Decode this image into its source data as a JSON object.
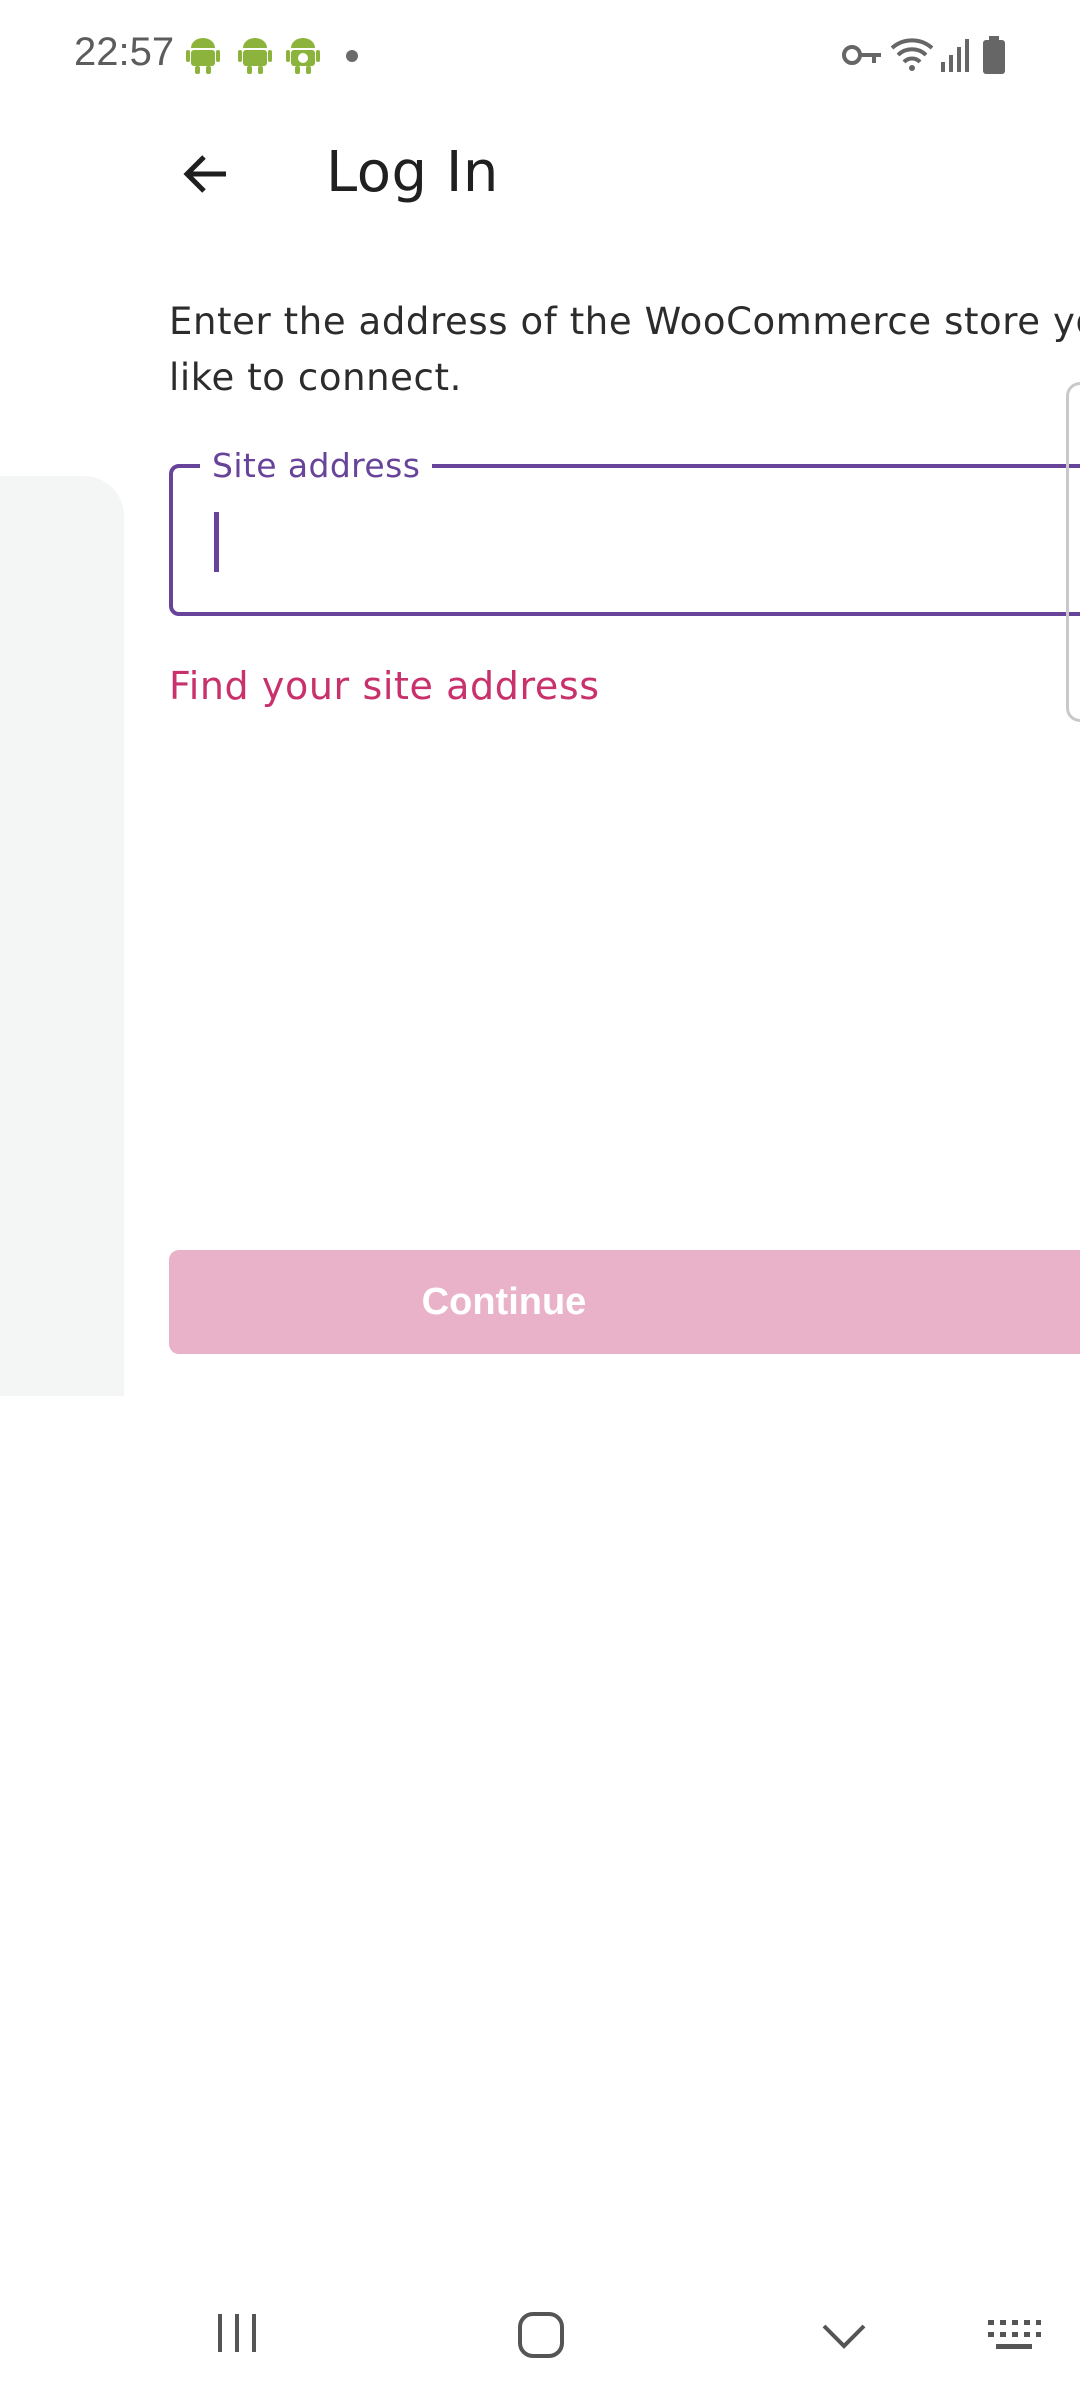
{
  "status_bar": {
    "time": "22:57",
    "left_icons": [
      "android-icon",
      "android-icon",
      "android-badge-icon",
      "dot-icon"
    ],
    "right_icons": [
      "key-icon",
      "wifi-icon",
      "signal-icon",
      "battery-icon"
    ]
  },
  "app_bar": {
    "back_icon": "arrow-left-icon",
    "title": "Log In"
  },
  "content": {
    "description_line1": "Enter the address of the WooCommerce store you",
    "description_line2": "like to connect.",
    "site_address": {
      "label": "Site address",
      "value": "",
      "placeholder": ""
    },
    "find_link": "Find your site address",
    "continue_label": "Continue"
  },
  "nav_bar": {
    "icons": [
      "recents-icon",
      "home-icon",
      "back-chevron-icon",
      "keyboard-icon"
    ]
  },
  "colors": {
    "accent_purple": "#674399",
    "link_pink": "#c8316b",
    "button_disabled": "#e9b2c8",
    "side_panel": "#f4f6f5"
  }
}
